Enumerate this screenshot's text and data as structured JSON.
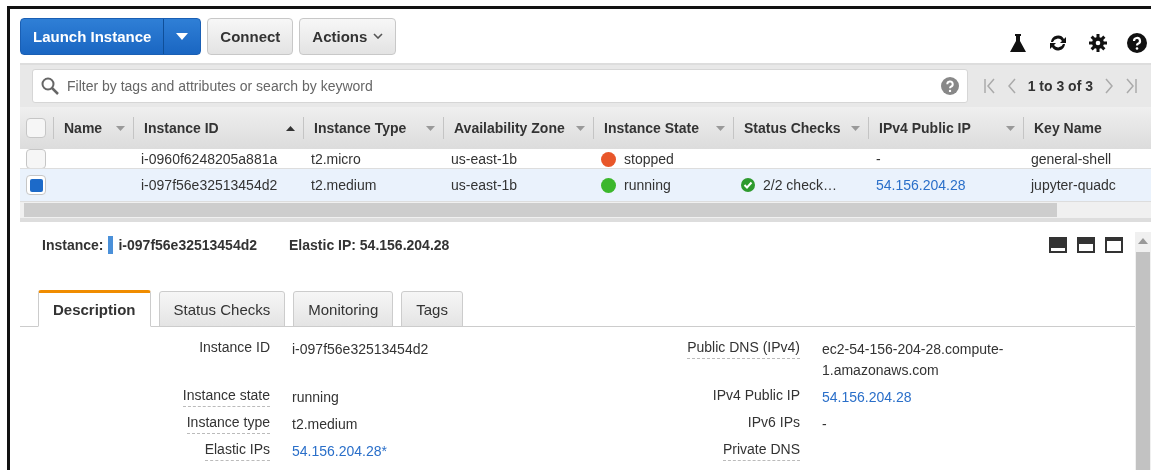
{
  "toolbar": {
    "launch_button": "Launch Instance",
    "connect_button": "Connect",
    "actions_button": "Actions"
  },
  "filter": {
    "placeholder": "Filter by tags and attributes or search by keyword",
    "pagination": "1 to 3 of 3"
  },
  "table": {
    "select_all": false,
    "columns": [
      {
        "label": "Name",
        "sorted": false,
        "menu": true
      },
      {
        "label": "Instance ID",
        "sorted": true,
        "menu": false
      },
      {
        "label": "Instance Type",
        "sorted": false,
        "menu": true
      },
      {
        "label": "Availability Zone",
        "sorted": false,
        "menu": true
      },
      {
        "label": "Instance State",
        "sorted": false,
        "menu": true
      },
      {
        "label": "Status Checks",
        "sorted": false,
        "menu": true
      },
      {
        "label": "IPv4 Public IP",
        "sorted": false,
        "menu": true
      },
      {
        "label": "Key Name",
        "sorted": false,
        "menu": false
      }
    ],
    "rows": [
      {
        "selected": false,
        "instance_id": "i-0960f6248205a881a",
        "type": "t2.micro",
        "zone": "us-east-1b",
        "state": "stopped",
        "color": "#e8562a",
        "checks_ok": false,
        "ip": "-",
        "ip_link": false,
        "key": "general-shell"
      },
      {
        "selected": true,
        "instance_id": "i-097f56e32513454d2",
        "type": "t2.medium",
        "zone": "us-east-1b",
        "state": "running",
        "color": "#3cb72c",
        "checks": "2/2 check…",
        "checks_ok": true,
        "ip": "54.156.204.28",
        "ip_link": true,
        "key": "jupyter-quadc"
      }
    ]
  },
  "detail": {
    "instance_label": "Instance:",
    "instance_id": "i-097f56e32513454d2",
    "elastic_ip": "Elastic IP: 54.156.204.28",
    "tabs": [
      {
        "label": "Description",
        "selected": true
      },
      {
        "label": "Status Checks",
        "selected": false
      },
      {
        "label": "Monitoring",
        "selected": false
      },
      {
        "label": "Tags",
        "selected": false
      }
    ],
    "left_fields": [
      {
        "label": "Instance ID",
        "value": "i-097f56e32513454d2",
        "kind": "text",
        "dotted": false
      },
      {
        "label": "Instance state",
        "value": "running",
        "kind": "text",
        "dotted": true
      },
      {
        "label": "Instance type",
        "value": "t2.medium",
        "kind": "text",
        "dotted": true
      },
      {
        "label": "Elastic IPs",
        "value": "54.156.204.28*",
        "kind": "link",
        "dotted": true
      }
    ],
    "right_fields": [
      {
        "label": "Public DNS (IPv4)",
        "value": "ec2-54-156-204-28.compute-1.amazonaws.com",
        "kind": "text",
        "dotted": true
      },
      {
        "label": "IPv4 Public IP",
        "value": "54.156.204.28",
        "kind": "link",
        "dotted": false
      },
      {
        "label": "IPv6 IPs",
        "value": "-",
        "kind": "text",
        "dotted": false
      },
      {
        "label": "Private DNS",
        "dotted": true
      }
    ]
  }
}
